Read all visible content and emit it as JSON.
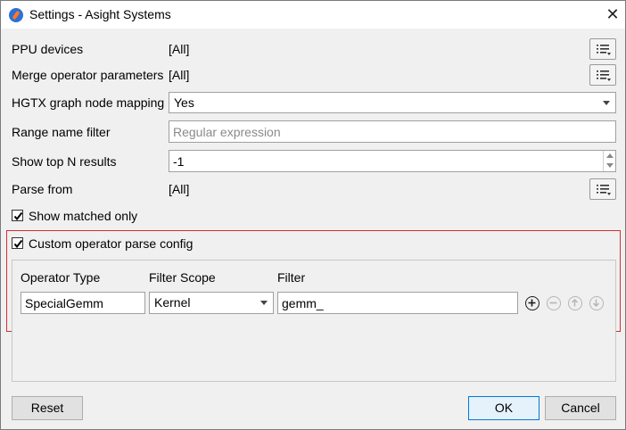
{
  "window": {
    "title": "Settings - Asight Systems"
  },
  "fields": {
    "ppu_devices": {
      "label": "PPU devices",
      "value": "[All]"
    },
    "merge_params": {
      "label": "Merge operator parameters",
      "value": "[All]"
    },
    "hgtx_mapping": {
      "label": "HGTX graph node mapping",
      "value": "Yes"
    },
    "range_filter": {
      "label": "Range name filter",
      "placeholder": "Regular expression",
      "value": ""
    },
    "top_n": {
      "label": "Show top N results",
      "value": "-1"
    },
    "parse_from": {
      "label": "Parse from",
      "value": "[All]"
    }
  },
  "checkboxes": {
    "show_matched": {
      "label": "Show matched only",
      "checked": true
    },
    "custom_parse": {
      "label": "Custom operator parse config",
      "checked": true
    }
  },
  "custom_table": {
    "headers": {
      "operator_type": "Operator Type",
      "filter_scope": "Filter Scope",
      "filter": "Filter"
    },
    "row": {
      "operator_type": "SpecialGemm",
      "filter_scope": "Kernel",
      "filter": "gemm_"
    }
  },
  "buttons": {
    "reset": "Reset",
    "ok": "OK",
    "cancel": "Cancel"
  },
  "colors": {
    "highlight_border": "#d32f2f",
    "default_button_border": "#0078d7"
  }
}
